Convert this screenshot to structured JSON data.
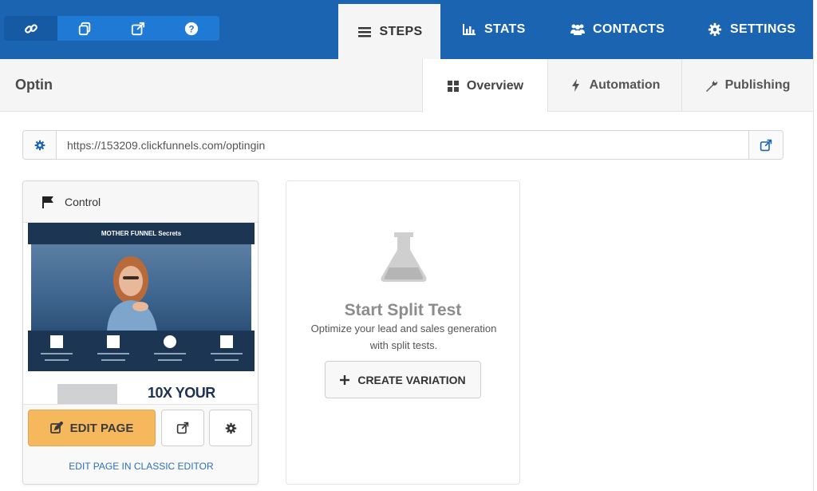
{
  "toolbar": {
    "icons": [
      "link-icon",
      "copy-icon",
      "external-link-icon",
      "help-icon"
    ]
  },
  "main_tabs": [
    {
      "label": "STEPS",
      "icon": "list-icon",
      "active": true
    },
    {
      "label": "STATS",
      "icon": "bar-chart-icon",
      "active": false
    },
    {
      "label": "CONTACTS",
      "icon": "users-icon",
      "active": false
    },
    {
      "label": "SETTINGS",
      "icon": "gear-icon",
      "active": false
    }
  ],
  "page": {
    "name": "Optin"
  },
  "sub_tabs": [
    {
      "label": "Overview",
      "icon": "grid-icon",
      "active": true
    },
    {
      "label": "Automation",
      "icon": "bolt-icon",
      "active": false
    },
    {
      "label": "Publishing",
      "icon": "wrench-icon",
      "active": false
    }
  ],
  "url_bar": {
    "url": "https://153209.clickfunnels.com/optingin"
  },
  "control_card": {
    "title": "Control",
    "preview_logo": "MOTHER FUNNEL Secrets",
    "preview_title": "10X YOUR",
    "edit_label": "EDIT PAGE",
    "classic_label": "EDIT PAGE IN CLASSIC EDITOR"
  },
  "split_test": {
    "title": "Start Split Test",
    "description": "Optimize your lead and sales generation with split tests.",
    "button_label": "CREATE VARIATION"
  },
  "colors": {
    "primary_blue": "#1a64b1",
    "edit_button": "#f5b85c",
    "link_blue": "#2c6fb8"
  }
}
